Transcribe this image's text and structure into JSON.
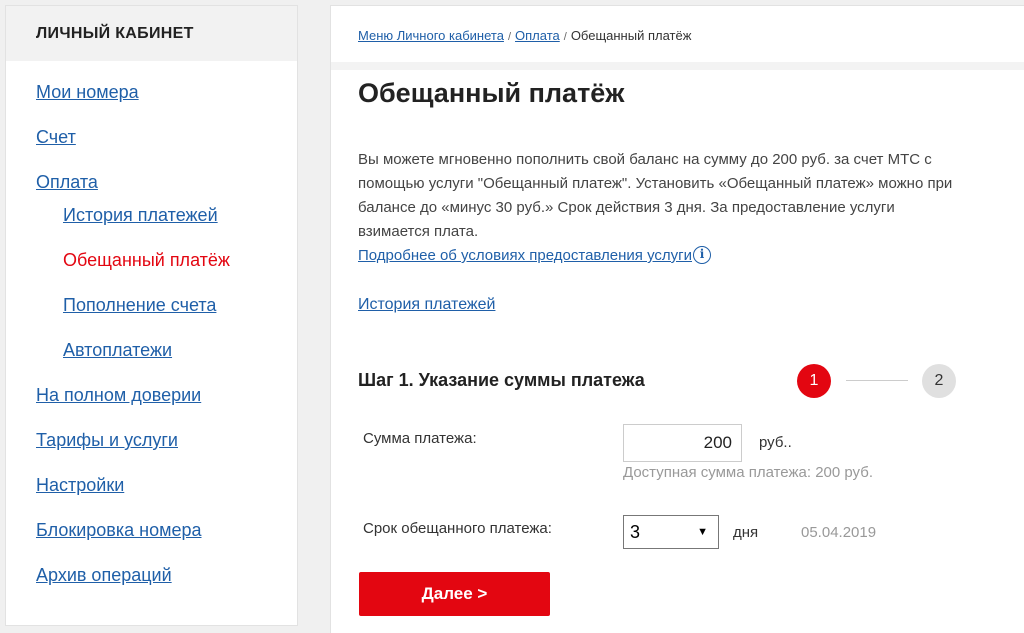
{
  "sidebar": {
    "title": "ЛИЧНЫЙ КАБИНЕТ",
    "items": [
      {
        "label": "Мои номера"
      },
      {
        "label": "Счет"
      },
      {
        "label": "Оплата"
      },
      {
        "label": "История платежей"
      },
      {
        "label": "Обещанный платёж"
      },
      {
        "label": "Пополнение счета"
      },
      {
        "label": "Автоплатежи"
      },
      {
        "label": "На полном доверии"
      },
      {
        "label": "Тарифы и услуги"
      },
      {
        "label": "Настройки"
      },
      {
        "label": "Блокировка номера"
      },
      {
        "label": "Архив операций"
      }
    ]
  },
  "breadcrumb": {
    "items": [
      "Меню Личного кабинета",
      "Оплата"
    ],
    "current": "Обещанный платёж",
    "separator": "/"
  },
  "page": {
    "title": "Обещанный платёж",
    "description": "Вы можете мгновенно пополнить свой баланс на сумму до 200 руб. за счет МТС с помощью услуги \"Обещанный платеж\". Установить «Обещанный платеж» можно при балансе до «минус 30 руб.» Срок действия 3 дня. За предоставление услуги взимается плата.",
    "conditions_link": "Подробнее об условиях предоставления услуги",
    "history_link": "История платежей"
  },
  "step": {
    "title": "Шаг 1. Указание суммы платежа",
    "current": "1",
    "next": "2"
  },
  "form": {
    "amount_label": "Сумма платежа:",
    "amount_value": "200",
    "amount_unit": "руб..",
    "amount_hint": "Доступная сумма платежа: 200 руб.",
    "term_label": "Срок обещанного платежа:",
    "term_value": "3",
    "term_unit": "дня",
    "term_date": "05.04.2019",
    "next_button": "Далее >"
  },
  "colors": {
    "accent": "#e30611",
    "link": "#1f5fa8"
  }
}
